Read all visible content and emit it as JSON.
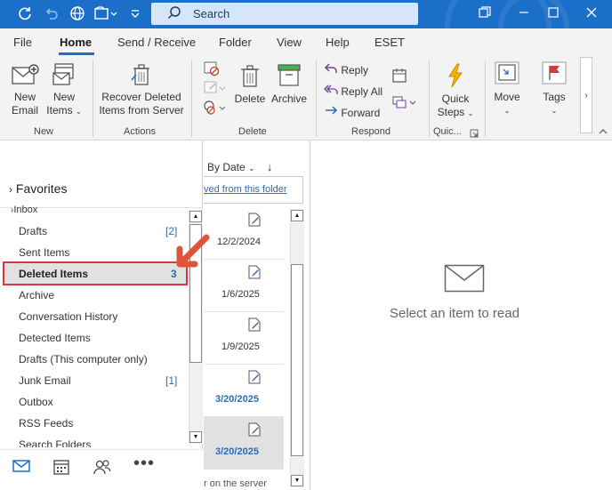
{
  "titlebar": {
    "search_placeholder": "Search",
    "icons": [
      "sync-icon",
      "undo-icon",
      "globe-icon",
      "folder-options-icon",
      "customize-icon",
      "search-icon",
      "restore-icon",
      "minimize-icon",
      "maximize-icon",
      "close-icon"
    ]
  },
  "menu": {
    "tabs": [
      "File",
      "Home",
      "Send / Receive",
      "Folder",
      "View",
      "Help",
      "ESET"
    ],
    "active": "Home"
  },
  "ribbon": {
    "new_email": "New\nEmail",
    "new_email_l1": "New",
    "new_email_l2": "Email",
    "new_items_l1": "New",
    "new_items_l2": "Items",
    "group_new": "New",
    "recover_l1": "Recover Deleted",
    "recover_l2": "Items from Server",
    "group_actions": "Actions",
    "delete": "Delete",
    "archive": "Archive",
    "group_delete": "Delete",
    "reply": "Reply",
    "reply_all": "Reply All",
    "forward": "Forward",
    "group_respond": "Respond",
    "quick_steps_l1": "Quick",
    "quick_steps_l2": "Steps",
    "group_quick": "Quic...",
    "move": "Move",
    "tags": "Tags"
  },
  "folders": {
    "favorites": "Favorites",
    "inbox": "Inbox",
    "items": [
      {
        "label": "Drafts",
        "count": "[2]"
      },
      {
        "label": "Sent Items",
        "count": ""
      },
      {
        "label": "Deleted Items",
        "count": "3"
      },
      {
        "label": "Archive",
        "count": ""
      },
      {
        "label": "Conversation History",
        "count": ""
      },
      {
        "label": "Detected Items",
        "count": ""
      },
      {
        "label": "Drafts (This computer only)",
        "count": ""
      },
      {
        "label": "Junk Email",
        "count": "[1]"
      },
      {
        "label": "Outbox",
        "count": ""
      },
      {
        "label": "RSS Feeds",
        "count": ""
      },
      {
        "label": "Search Folders",
        "count": ""
      }
    ]
  },
  "message_list": {
    "sort_label": "By Date",
    "server_link": "ved from this folder",
    "bottom_text": "r on the server",
    "messages": [
      {
        "date": "12/2/2024"
      },
      {
        "date": "1/6/2025"
      },
      {
        "date": "1/9/2025"
      },
      {
        "date": "3/20/2025"
      },
      {
        "date": "3/20/2025"
      }
    ]
  },
  "reading_pane": {
    "empty_text": "Select an item to read"
  },
  "colors": {
    "titlebar": "#1c6fc9",
    "accent_blue": "#2b6cb5",
    "highlight_red": "#d9363e",
    "annotation_orange": "#e0553a"
  }
}
